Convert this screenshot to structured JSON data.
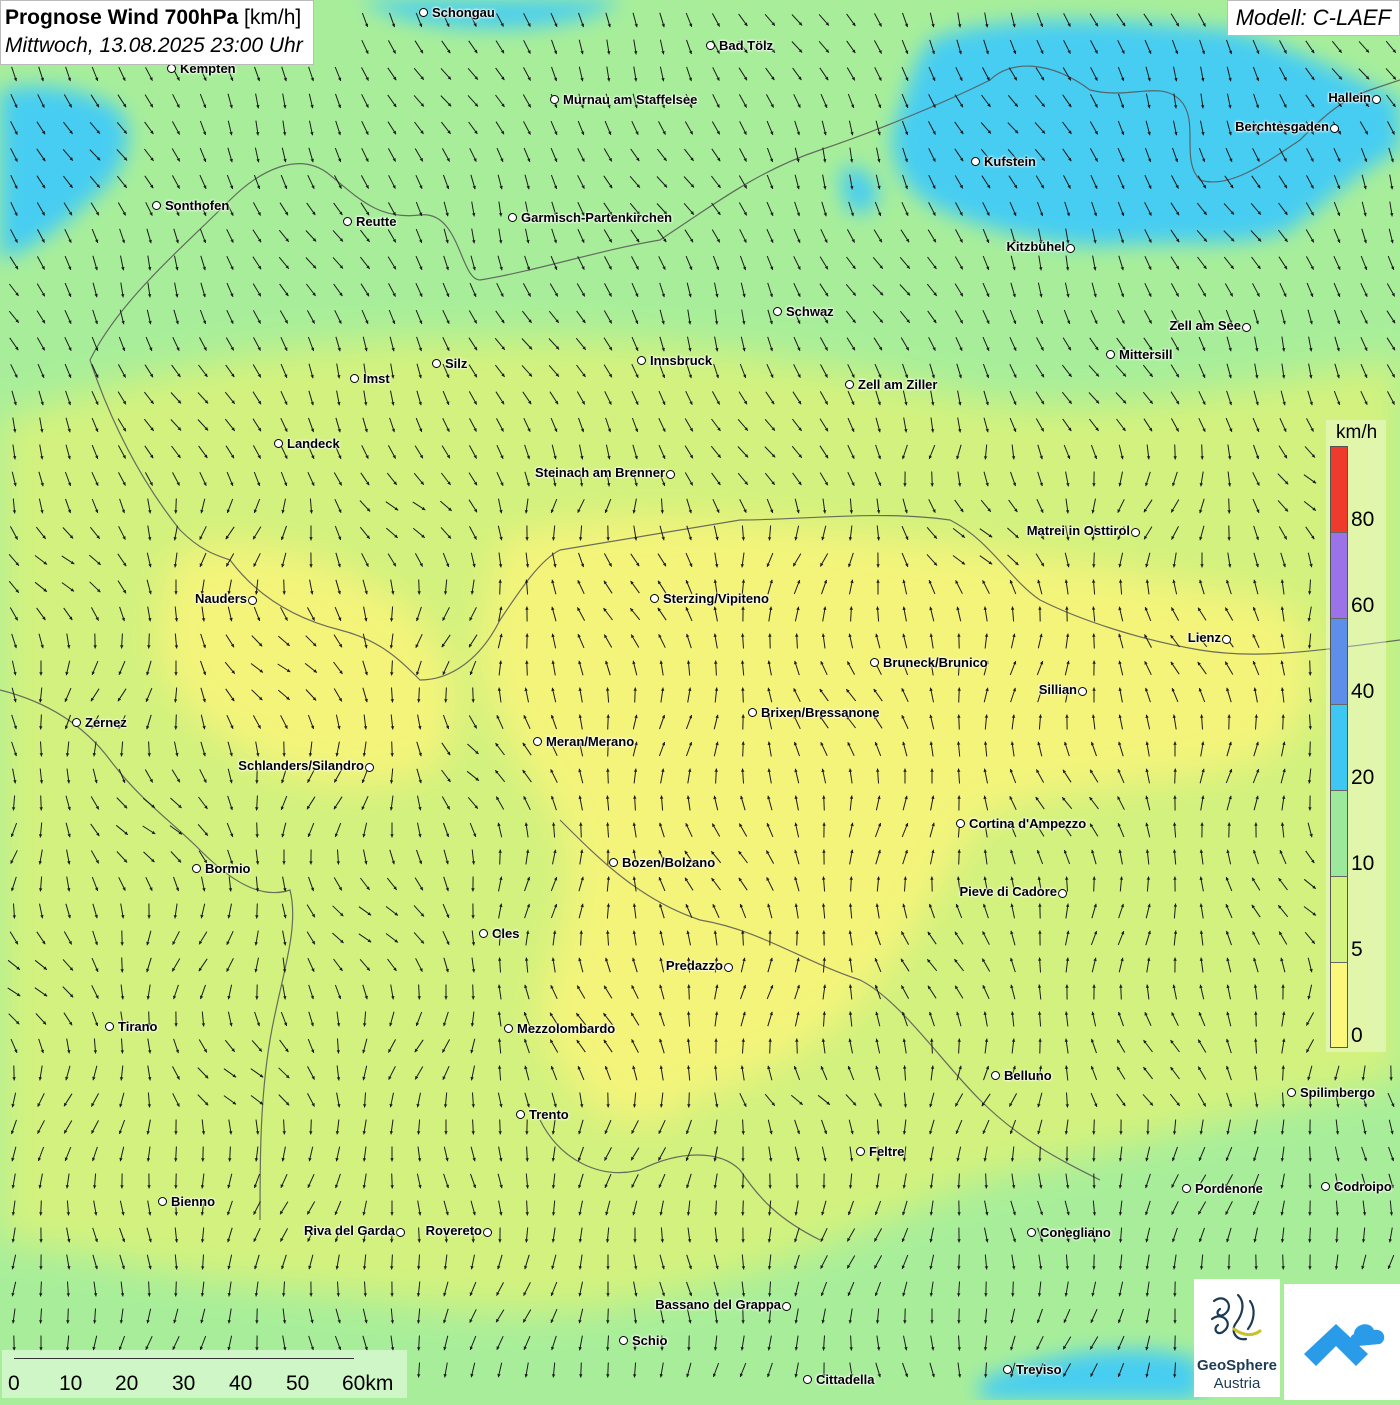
{
  "title": {
    "main": "Prognose Wind 700hPa",
    "unit": "[km/h]",
    "datetime": "Mittwoch, 13.08.2025 23:00 Uhr"
  },
  "model": "Modell: C-LAEF",
  "colors": {
    "wind_0_5": "#fbf77a",
    "wind_5_10": "#d3f27e",
    "wind_10_20": "#9de99b",
    "wind_20_40": "#3fc7f3",
    "wind_40_60": "#5d8fea",
    "wind_60_80": "#9c72e9",
    "wind_80_plus": "#ef3b2c",
    "arrow": "#1a1a1a",
    "border": "#555555"
  },
  "legend": {
    "unit": "km/h",
    "ticks": [
      "80",
      "60",
      "40",
      "20",
      "10",
      "5",
      "0"
    ]
  },
  "scalebar": {
    "labels": [
      "0",
      "10",
      "20",
      "30",
      "40",
      "50",
      "60km"
    ]
  },
  "logos": {
    "geosphere_name": "GeoSphere",
    "geosphere_sub": "Austria",
    "geosphere_icon": "geosphere-logo-icon",
    "app_icon": "warn-app-logo-icon"
  },
  "cities": [
    {
      "id": "schongau",
      "name": "Schongau",
      "label_side": "right"
    },
    {
      "id": "bad-toelz",
      "name": "Bad Tölz",
      "label_side": "right"
    },
    {
      "id": "kempten",
      "name": "Kempten",
      "label_side": "right"
    },
    {
      "id": "murnau",
      "name": "Murnau am Staffelsee",
      "label_side": "right"
    },
    {
      "id": "hallein",
      "name": "Hallein",
      "label_side": "left"
    },
    {
      "id": "berchtesgaden",
      "name": "Berchtesgaden",
      "label_side": "left"
    },
    {
      "id": "kufstein",
      "name": "Kufstein",
      "label_side": "right"
    },
    {
      "id": "sonthofen",
      "name": "Sonthofen",
      "label_side": "right"
    },
    {
      "id": "reutte",
      "name": "Reutte",
      "label_side": "right"
    },
    {
      "id": "garmisch",
      "name": "Garmisch-Partenkirchen",
      "label_side": "right"
    },
    {
      "id": "kitzbuehel",
      "name": "Kitzbühel",
      "label_side": "left"
    },
    {
      "id": "schwaz",
      "name": "Schwaz",
      "label_side": "right"
    },
    {
      "id": "zell-am-see",
      "name": "Zell am See",
      "label_side": "left"
    },
    {
      "id": "mittersill",
      "name": "Mittersill",
      "label_side": "right"
    },
    {
      "id": "innsbruck",
      "name": "Innsbruck",
      "label_side": "right"
    },
    {
      "id": "silz",
      "name": "Silz",
      "label_side": "right"
    },
    {
      "id": "imst",
      "name": "Imst",
      "label_side": "right"
    },
    {
      "id": "zell-am-ziller",
      "name": "Zell am Ziller",
      "label_side": "right"
    },
    {
      "id": "landeck",
      "name": "Landeck",
      "label_side": "right"
    },
    {
      "id": "steinach",
      "name": "Steinach am Brenner",
      "label_side": "left"
    },
    {
      "id": "matrei",
      "name": "Matrei in Osttirol",
      "label_side": "left"
    },
    {
      "id": "nauders",
      "name": "Nauders",
      "label_side": "left"
    },
    {
      "id": "sterzing",
      "name": "Sterzing/Vipiteno",
      "label_side": "right"
    },
    {
      "id": "lienz",
      "name": "Lienz",
      "label_side": "left"
    },
    {
      "id": "bruneck",
      "name": "Bruneck/Brunico",
      "label_side": "right"
    },
    {
      "id": "sillian",
      "name": "Sillian",
      "label_side": "left"
    },
    {
      "id": "zernez",
      "name": "Zernez",
      "label_side": "right"
    },
    {
      "id": "brixen",
      "name": "Brixen/Bressanone",
      "label_side": "right"
    },
    {
      "id": "meran",
      "name": "Meran/Merano",
      "label_side": "right"
    },
    {
      "id": "schlanders",
      "name": "Schlanders/Silandro",
      "label_side": "left"
    },
    {
      "id": "cortina",
      "name": "Cortina d'Ampezzo",
      "label_side": "right"
    },
    {
      "id": "bozen",
      "name": "Bozen/Bolzano",
      "label_side": "right"
    },
    {
      "id": "bormio",
      "name": "Bormio",
      "label_side": "right"
    },
    {
      "id": "pieve",
      "name": "Pieve di Cadore",
      "label_side": "left"
    },
    {
      "id": "cles",
      "name": "Cles",
      "label_side": "right"
    },
    {
      "id": "predazzo",
      "name": "Predazzo",
      "label_side": "left"
    },
    {
      "id": "tirano",
      "name": "Tirano",
      "label_side": "right"
    },
    {
      "id": "mezzolombardo",
      "name": "Mezzolombardo",
      "label_side": "right"
    },
    {
      "id": "belluno",
      "name": "Belluno",
      "label_side": "right"
    },
    {
      "id": "spilimbergo",
      "name": "Spilimbergo",
      "label_side": "right"
    },
    {
      "id": "trento",
      "name": "Trento",
      "label_side": "right"
    },
    {
      "id": "feltre",
      "name": "Feltre",
      "label_side": "right"
    },
    {
      "id": "pordenone",
      "name": "Pordenone",
      "label_side": "right"
    },
    {
      "id": "codroipo",
      "name": "Codroipo",
      "label_side": "right"
    },
    {
      "id": "bienno",
      "name": "Bienno",
      "label_side": "right"
    },
    {
      "id": "riva",
      "name": "Riva del Garda",
      "label_side": "left"
    },
    {
      "id": "rovereto",
      "name": "Rovereto",
      "label_side": "left"
    },
    {
      "id": "conegliano",
      "name": "Conegliano",
      "label_side": "right"
    },
    {
      "id": "bassano",
      "name": "Bassano del Grappa",
      "label_side": "left"
    },
    {
      "id": "schio",
      "name": "Schio",
      "label_side": "right"
    },
    {
      "id": "treviso",
      "name": "Treviso",
      "label_side": "right"
    },
    {
      "id": "cittadella",
      "name": "Cittadella",
      "label_side": "right"
    }
  ]
}
